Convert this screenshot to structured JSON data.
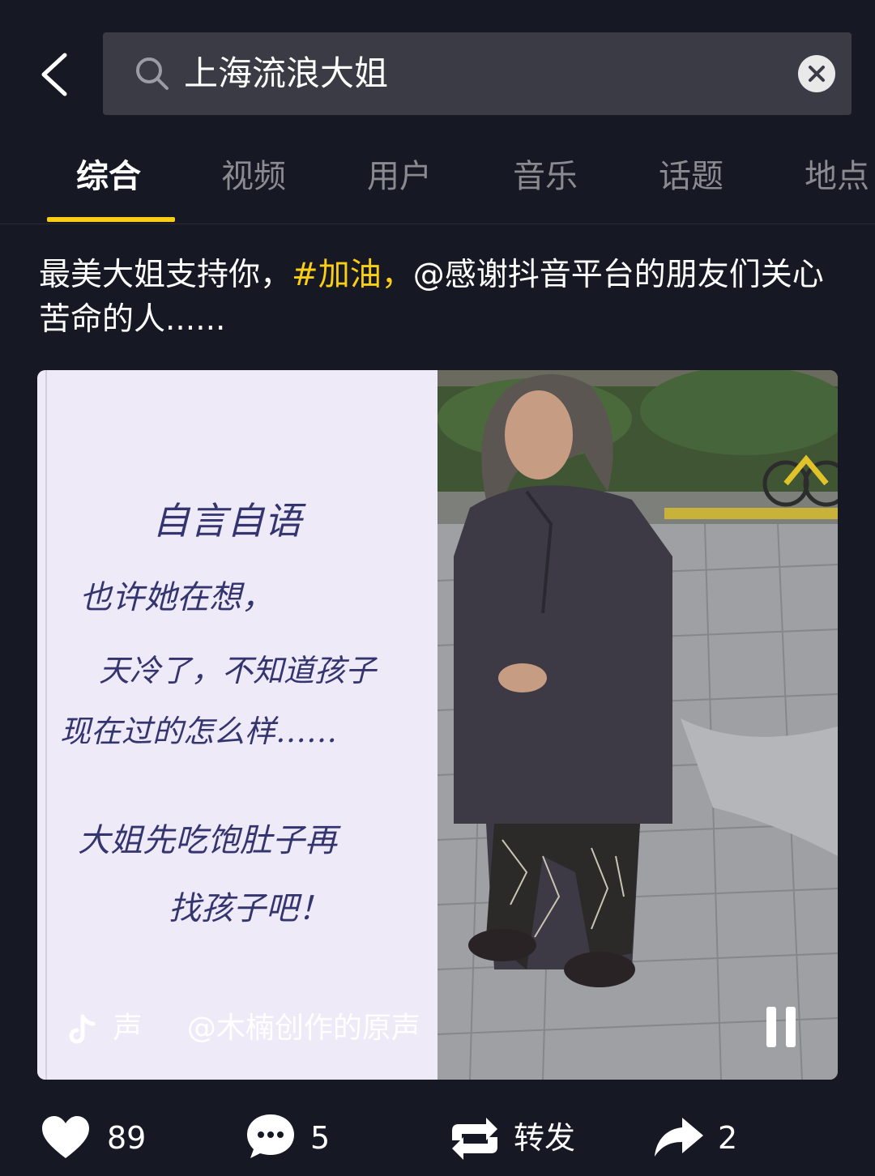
{
  "search": {
    "query": "上海流浪大姐"
  },
  "tabs": [
    "综合",
    "视频",
    "用户",
    "音乐",
    "话题",
    "地点"
  ],
  "post": {
    "caption_pre": "最美大姐支持你，",
    "caption_tag": "#加油，",
    "caption_post": "@感谢抖音平台的朋友们关心苦命的人......",
    "note": {
      "title": "自言自语",
      "lines": [
        "也许她在想，",
        "天冷了，不知道孩子",
        "现在过的怎么样……",
        "大姐先吃饱肚子再",
        "找孩子吧！"
      ]
    },
    "music_prefix": "声",
    "music": "@木楠创作的原声"
  },
  "actions": {
    "likes": "89",
    "comments": "5",
    "repost": "转发",
    "shares": "2"
  },
  "colors": {
    "background": "#161823",
    "accent": "#face15",
    "search_bg": "#3a3b44"
  }
}
